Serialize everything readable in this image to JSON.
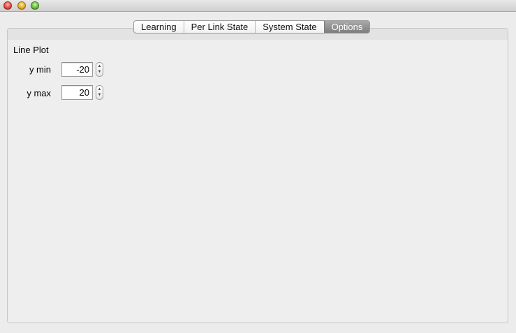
{
  "tabs": [
    {
      "label": "Learning",
      "selected": false
    },
    {
      "label": "Per Link State",
      "selected": false
    },
    {
      "label": "System State",
      "selected": false
    },
    {
      "label": "Options",
      "selected": true
    }
  ],
  "options": {
    "section_title": "Line Plot",
    "y_min": {
      "label": "y min",
      "value": "-20"
    },
    "y_max": {
      "label": "y max",
      "value": "20"
    }
  },
  "icons": {
    "stepper_up": "▲",
    "stepper_down": "▼"
  },
  "colors": {
    "selected_tab": "#8e8e8e",
    "window_background": "#ececec"
  }
}
